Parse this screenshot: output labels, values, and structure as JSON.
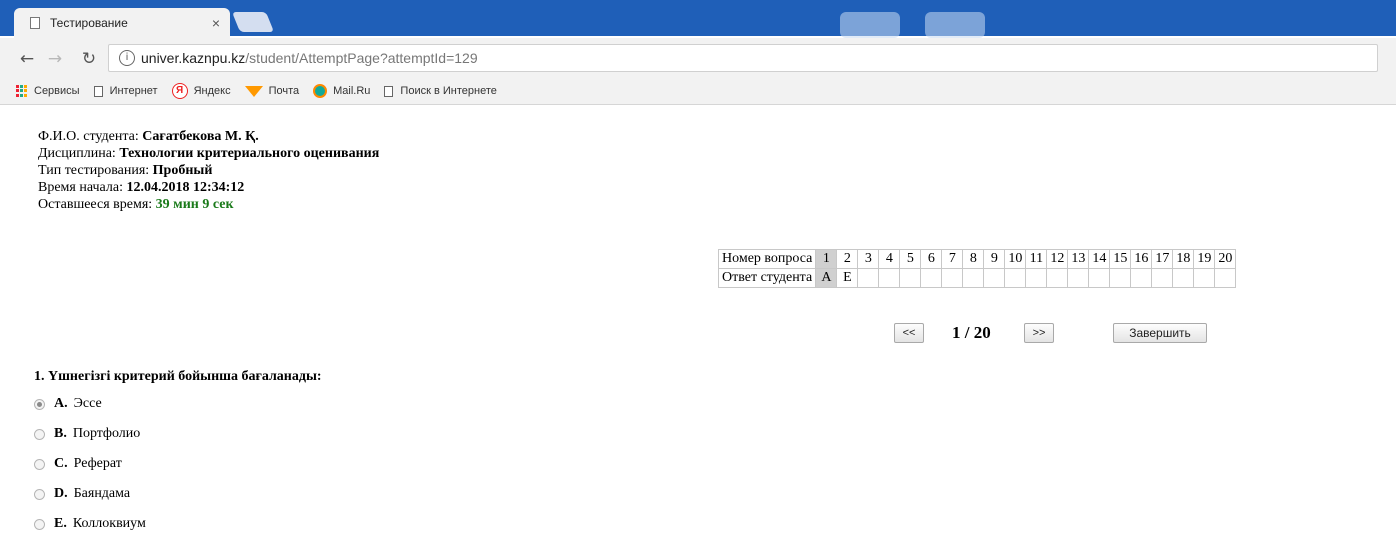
{
  "browser": {
    "tab_title": "Тестирование",
    "tab_close": "×",
    "url_host": "univer.kaznpu.kz",
    "url_path": "/student/AttemptPage?attemptId=129",
    "bookmarks": [
      "Сервисы",
      "Интернет",
      "Яндекс",
      "Почта",
      "Mail.Ru",
      "Поиск в Интернете"
    ]
  },
  "student_info": {
    "name_label": "Ф.И.О. студента:",
    "name_value": "Сағатбекова М. Қ.",
    "discipline_label": "Дисциплина:",
    "discipline_value": "Технологии критериального оценивания",
    "type_label": "Тип тестирования:",
    "type_value": "Пробный",
    "start_label": "Время начала:",
    "start_value": "12.04.2018 12:34:12",
    "remaining_label": "Оставшееся время:",
    "remaining_value": "39 мин 9 сек"
  },
  "answer_table": {
    "row1_label": "Номер вопроса",
    "row2_label": "Ответ студента",
    "numbers": [
      "1",
      "2",
      "3",
      "4",
      "5",
      "6",
      "7",
      "8",
      "9",
      "10",
      "11",
      "12",
      "13",
      "14",
      "15",
      "16",
      "17",
      "18",
      "19",
      "20"
    ],
    "answers": [
      "A",
      "E",
      "",
      "",
      "",
      "",
      "",
      "",
      "",
      "",
      "",
      "",
      "",
      "",
      "",
      "",
      "",
      "",
      "",
      ""
    ],
    "current": 1
  },
  "pager": {
    "prev": "<<",
    "count": "1 / 20",
    "next": ">>",
    "finish": "Завершить"
  },
  "question": {
    "text": "1.  Үшнегізгі критерий бойынша бағаланады:",
    "options": [
      {
        "letter": "A.",
        "text": "Эссе",
        "checked": true
      },
      {
        "letter": "B.",
        "text": "Портфолио",
        "checked": false
      },
      {
        "letter": "C.",
        "text": "Реферат",
        "checked": false
      },
      {
        "letter": "D.",
        "text": "Баяндама",
        "checked": false
      },
      {
        "letter": "E.",
        "text": "Коллоквиум",
        "checked": false
      }
    ]
  }
}
